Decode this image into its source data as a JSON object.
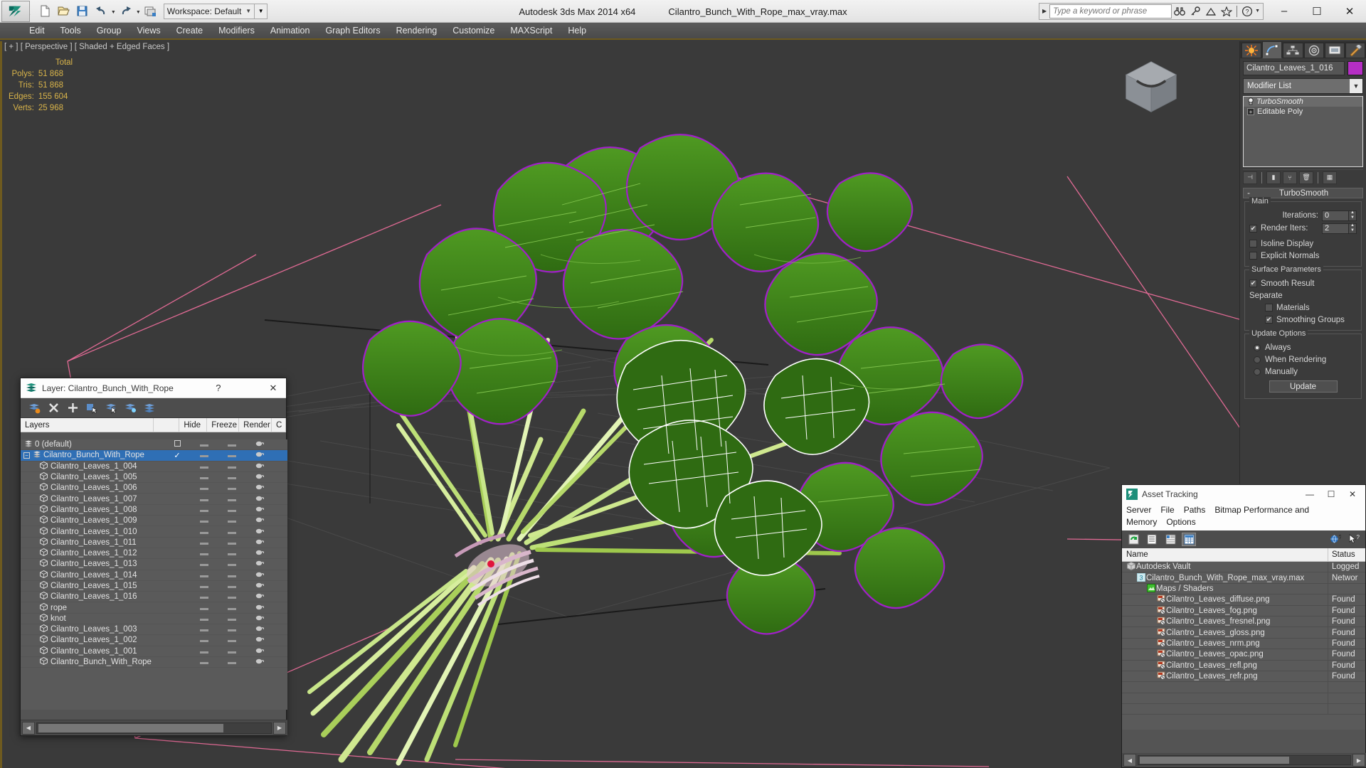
{
  "titlebar": {
    "app_title": "Autodesk 3ds Max  2014 x64",
    "file_title": "Cilantro_Bunch_With_Rope_max_vray.max",
    "workspace_label": "Workspace: Default",
    "search_placeholder": "Type a keyword or phrase",
    "quick_access": [
      "new-file-icon",
      "open-file-icon",
      "save-file-icon",
      "undo-icon",
      "redo-icon",
      "set-project-icon"
    ],
    "search_icons": [
      "binoculars-icon",
      "key-icon",
      "dish-icon",
      "star-icon",
      "help-icon"
    ],
    "window_buttons": {
      "minimize": "–",
      "maximize": "☐",
      "close": "✕"
    }
  },
  "menubar": {
    "items": [
      "Edit",
      "Tools",
      "Group",
      "Views",
      "Create",
      "Modifiers",
      "Animation",
      "Graph Editors",
      "Rendering",
      "Customize",
      "MAXScript",
      "Help"
    ]
  },
  "viewport": {
    "label": "[ + ] [ Perspective ] [ Shaded + Edged Faces ]",
    "stats": {
      "header": "Total",
      "rows": [
        {
          "label": "Polys:",
          "value": "51 868"
        },
        {
          "label": "Tris:",
          "value": "51 868"
        },
        {
          "label": "Edges:",
          "value": "155 604"
        },
        {
          "label": "Verts:",
          "value": "25 968"
        }
      ]
    }
  },
  "command_panel": {
    "tabs": [
      "create-tab",
      "modify-tab",
      "hierarchy-tab",
      "motion-tab",
      "display-tab",
      "utilities-tab"
    ],
    "active_tab_index": 1,
    "object_name": "Cilantro_Leaves_1_016",
    "object_color": "#b52ec4",
    "modifier_list_label": "Modifier List",
    "modifier_stack": [
      {
        "name": "TurboSmooth",
        "icon": "lightbulb-icon",
        "selected": true
      },
      {
        "name": "Editable Poly",
        "icon": "expand-plus-icon",
        "selected": false
      }
    ],
    "stack_tools": [
      "pin-stack-icon",
      "show-end-result-icon",
      "make-unique-icon",
      "remove-modifier-icon",
      "configure-sets-icon"
    ],
    "rollout": {
      "title": "TurboSmooth",
      "minimize_sign": "-",
      "groups": [
        {
          "title": "Main",
          "iterations_label": "Iterations:",
          "iterations_value": "0",
          "render_iters_label": "Render Iters:",
          "render_iters_value": "2",
          "render_iters_checked": true,
          "isoline_label": "Isoline Display",
          "isoline_checked": false,
          "explicit_label": "Explicit Normals",
          "explicit_checked": false
        },
        {
          "title": "Surface Parameters",
          "smooth_result_label": "Smooth Result",
          "smooth_result_checked": true,
          "separate_label": "Separate",
          "materials_label": "Materials",
          "materials_checked": false,
          "smoothing_groups_label": "Smoothing Groups",
          "smoothing_groups_checked": true
        },
        {
          "title": "Update Options",
          "options": [
            {
              "label": "Always",
              "selected": true
            },
            {
              "label": "When Rendering",
              "selected": false
            },
            {
              "label": "Manually",
              "selected": false
            }
          ],
          "update_button": "Update"
        }
      ]
    }
  },
  "layer_dialog": {
    "title": "Layer: Cilantro_Bunch_With_Rope",
    "help_button": "?",
    "close_button": "✕",
    "toolbar": [
      "new-layer-icon",
      "delete-layer-icon",
      "add-layer-icon",
      "select-objects-icon",
      "select-highlighted-icon",
      "add-selection-icon",
      "set-current-icon"
    ],
    "columns": [
      "Layers",
      "",
      "Hide",
      "Freeze",
      "Render",
      "C"
    ],
    "rows": [
      {
        "name": "0 (default)",
        "indent": 0,
        "icon": "layer-icon",
        "selected": false,
        "expand": false,
        "current": false,
        "box": true
      },
      {
        "name": "Cilantro_Bunch_With_Rope",
        "indent": 0,
        "icon": "layer-icon",
        "selected": true,
        "expand": true,
        "current": true,
        "box": false
      },
      {
        "name": "Cilantro_Leaves_1_004",
        "indent": 1,
        "icon": "object-icon",
        "selected": false
      },
      {
        "name": "Cilantro_Leaves_1_005",
        "indent": 1,
        "icon": "object-icon",
        "selected": false
      },
      {
        "name": "Cilantro_Leaves_1_006",
        "indent": 1,
        "icon": "object-icon",
        "selected": false
      },
      {
        "name": "Cilantro_Leaves_1_007",
        "indent": 1,
        "icon": "object-icon",
        "selected": false
      },
      {
        "name": "Cilantro_Leaves_1_008",
        "indent": 1,
        "icon": "object-icon",
        "selected": false
      },
      {
        "name": "Cilantro_Leaves_1_009",
        "indent": 1,
        "icon": "object-icon",
        "selected": false
      },
      {
        "name": "Cilantro_Leaves_1_010",
        "indent": 1,
        "icon": "object-icon",
        "selected": false
      },
      {
        "name": "Cilantro_Leaves_1_011",
        "indent": 1,
        "icon": "object-icon",
        "selected": false
      },
      {
        "name": "Cilantro_Leaves_1_012",
        "indent": 1,
        "icon": "object-icon",
        "selected": false
      },
      {
        "name": "Cilantro_Leaves_1_013",
        "indent": 1,
        "icon": "object-icon",
        "selected": false
      },
      {
        "name": "Cilantro_Leaves_1_014",
        "indent": 1,
        "icon": "object-icon",
        "selected": false
      },
      {
        "name": "Cilantro_Leaves_1_015",
        "indent": 1,
        "icon": "object-icon",
        "selected": false
      },
      {
        "name": "Cilantro_Leaves_1_016",
        "indent": 1,
        "icon": "object-icon",
        "selected": false
      },
      {
        "name": "rope",
        "indent": 1,
        "icon": "object-icon",
        "selected": false
      },
      {
        "name": "knot",
        "indent": 1,
        "icon": "object-icon",
        "selected": false
      },
      {
        "name": "Cilantro_Leaves_1_003",
        "indent": 1,
        "icon": "object-icon",
        "selected": false
      },
      {
        "name": "Cilantro_Leaves_1_002",
        "indent": 1,
        "icon": "object-icon",
        "selected": false
      },
      {
        "name": "Cilantro_Leaves_1_001",
        "indent": 1,
        "icon": "object-icon",
        "selected": false
      },
      {
        "name": "Cilantro_Bunch_With_Rope",
        "indent": 1,
        "icon": "object-icon",
        "selected": false
      }
    ]
  },
  "asset_tracking": {
    "title": "Asset Tracking",
    "window_buttons": {
      "minimize": "—",
      "maximize": "☐",
      "close": "✕"
    },
    "menus": [
      "Server",
      "File",
      "Paths",
      "Bitmap Performance and Memory",
      "Options"
    ],
    "toolbar": [
      "refresh-icon",
      "list-view-icon",
      "detail-view-icon",
      "grid-view-icon",
      "globe-help-icon",
      "help-cursor-icon"
    ],
    "columns": [
      "Name",
      "Status"
    ],
    "rows": [
      {
        "name": "Autodesk Vault",
        "status": "Logged",
        "indent": 0,
        "icon": "vault-icon"
      },
      {
        "name": "Cilantro_Bunch_With_Rope_max_vray.max",
        "status": "Networ",
        "indent": 1,
        "icon": "max-file-icon"
      },
      {
        "name": "Maps / Shaders",
        "status": "",
        "indent": 2,
        "icon": "maps-icon"
      },
      {
        "name": "Cilantro_Leaves_diffuse.png",
        "status": "Found",
        "indent": 3,
        "icon": "bitmap-icon"
      },
      {
        "name": "Cilantro_Leaves_fog.png",
        "status": "Found",
        "indent": 3,
        "icon": "bitmap-icon"
      },
      {
        "name": "Cilantro_Leaves_fresnel.png",
        "status": "Found",
        "indent": 3,
        "icon": "bitmap-icon"
      },
      {
        "name": "Cilantro_Leaves_gloss.png",
        "status": "Found",
        "indent": 3,
        "icon": "bitmap-icon"
      },
      {
        "name": "Cilantro_Leaves_nrm.png",
        "status": "Found",
        "indent": 3,
        "icon": "bitmap-icon"
      },
      {
        "name": "Cilantro_Leaves_opac.png",
        "status": "Found",
        "indent": 3,
        "icon": "bitmap-icon"
      },
      {
        "name": "Cilantro_Leaves_refl.png",
        "status": "Found",
        "indent": 3,
        "icon": "bitmap-icon"
      },
      {
        "name": "Cilantro_Leaves_refr.png",
        "status": "Found",
        "indent": 3,
        "icon": "bitmap-icon"
      }
    ]
  }
}
